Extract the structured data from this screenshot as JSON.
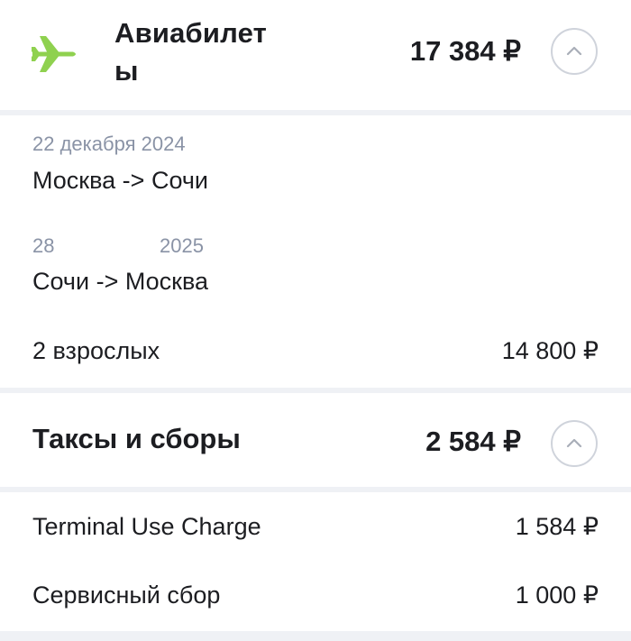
{
  "flights": {
    "title": "Авиабилеты",
    "total": "17 384 ₽",
    "segments": [
      {
        "date": "22 декабря 2024",
        "route": "Москва -> Сочи"
      },
      {
        "date_day": "28",
        "date_year": "2025",
        "route": "Сочи -> Москва"
      }
    ],
    "passengers": {
      "label": "2 взрослых",
      "price": "14 800 ₽"
    }
  },
  "taxes": {
    "title": "Таксы и сборы",
    "total": "2 584 ₽",
    "items": [
      {
        "label": "Terminal Use Charge",
        "price": "1 584 ₽"
      },
      {
        "label": "Сервисный сбор",
        "price": "1 000 ₽"
      }
    ]
  },
  "colors": {
    "accent_plane": "#8fd14f",
    "text_primary": "#1c1d21",
    "text_secondary": "#8a93a6",
    "background": "#eff1f5"
  },
  "icons": {
    "flights": "airplane-icon",
    "toggle": "chevron-up-icon"
  }
}
